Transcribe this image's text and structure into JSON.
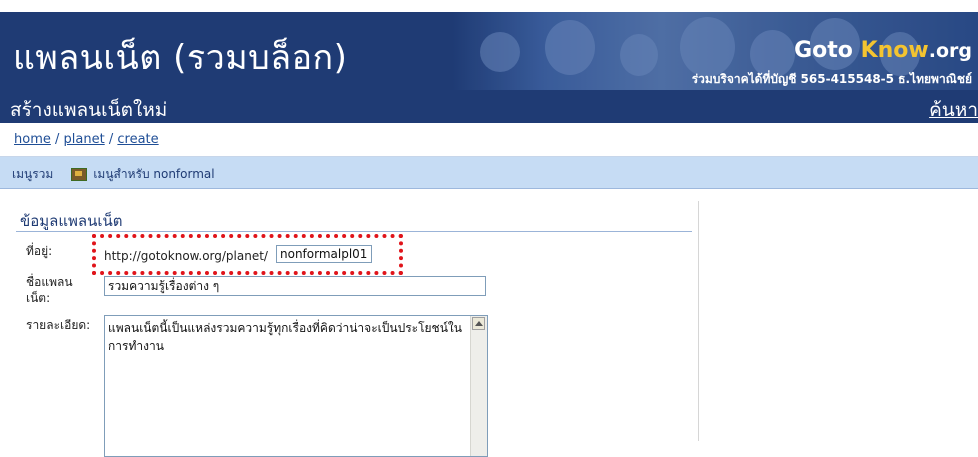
{
  "header": {
    "site_title": "แพลนเน็ต (รวมบล็อก)",
    "brand_goto": "Goto",
    "brand_know": "Know",
    "brand_org": ".org",
    "donate_text": "ร่วมบริจาคได้ที่บัญชี 565-415548-5 ธ.ไทยพาณิชย์"
  },
  "subheader": {
    "page_heading": "สร้างแพลนเน็ตใหม่",
    "search_link": "ค้นหา"
  },
  "breadcrumb": {
    "items": [
      "home",
      "planet",
      "create"
    ],
    "separator": "/"
  },
  "menu": {
    "main_label": "เมนูรวม",
    "nonformal_label": "เมนูสำหรับ nonformal"
  },
  "form": {
    "section_title": "ข้อมูลแพลนเน็ต",
    "address_label": "ที่อยู่:",
    "url_prefix": "http://gotoknow.org/planet/",
    "address_value": "nonformalpl01",
    "name_label": "ชื่อแพลนเน็ต:",
    "name_value": "รวมความรู้เรื่องต่าง ๆ",
    "description_label": "รายละเอียด:",
    "description_value": "แพลนเน็ตนี้เป็นแหล่งรวมความรู้ทุกเรื่องที่คิดว่าน่าจะเป็นประโยชน์ในการทำงาน"
  },
  "colors": {
    "header_bg": "#1f3b74",
    "menu_bg": "#c6dcf4",
    "highlight": "#e0141a",
    "link": "#1f4e96"
  }
}
